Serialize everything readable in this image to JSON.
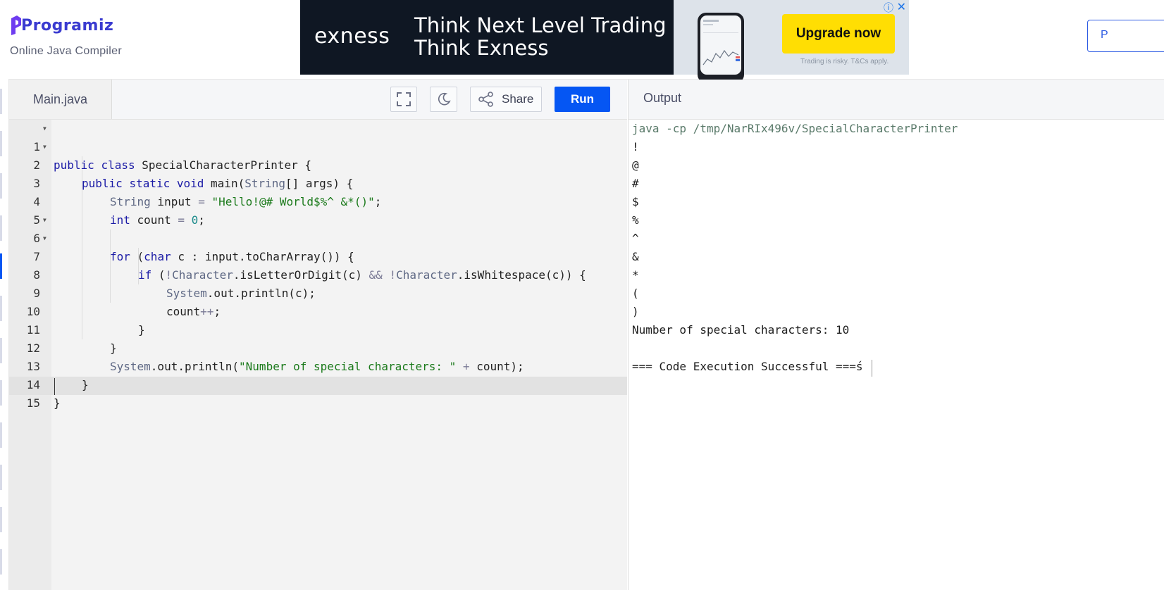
{
  "brand": {
    "logo_text": "Programiz",
    "subtitle": "Online Java Compiler"
  },
  "ad": {
    "brand": "exness",
    "headline_1": "Think Next Level Trading",
    "headline_2": "Think Exness",
    "cta": "Upgrade now",
    "note": "Trading is risky. T&Cs apply.",
    "info_icon": "info-icon",
    "close_icon": "close-icon"
  },
  "side_button": {
    "label": "P"
  },
  "editor": {
    "tab_label": "Main.java",
    "share_label": "Share",
    "run_label": "Run",
    "active_line": 15,
    "lines": [
      {
        "n": "1",
        "fold": true
      },
      {
        "n": "2",
        "fold": true
      },
      {
        "n": "3",
        "fold": false
      },
      {
        "n": "4",
        "fold": false
      },
      {
        "n": "5",
        "fold": false
      },
      {
        "n": "6",
        "fold": true
      },
      {
        "n": "7",
        "fold": true
      },
      {
        "n": "8",
        "fold": false
      },
      {
        "n": "9",
        "fold": false
      },
      {
        "n": "10",
        "fold": false
      },
      {
        "n": "11",
        "fold": false
      },
      {
        "n": "12",
        "fold": false
      },
      {
        "n": "13",
        "fold": false
      },
      {
        "n": "14",
        "fold": false
      },
      {
        "n": "15",
        "fold": false
      }
    ],
    "code": {
      "l1": {
        "a": "public",
        "b": " ",
        "c": "class",
        "d": " SpecialCharacterPrinter {"
      },
      "l2": {
        "a": "public",
        "b": " ",
        "c": "static",
        "d": " ",
        "e": "void",
        "f": " main(",
        "g": "String",
        "h": "[] args) {"
      },
      "l3": {
        "a": "String",
        "b": " input ",
        "c": "=",
        "d": " ",
        "e": "\"Hello!@# World$%^ &*()\"",
        "f": ";"
      },
      "l4": {
        "a": "int",
        "b": " count ",
        "c": "=",
        "d": " ",
        "e": "0",
        "f": ";"
      },
      "l6": {
        "a": "for",
        "b": " (",
        "c": "char",
        "d": " c : input.toCharArray()) {"
      },
      "l7": {
        "a": "if",
        "b": " (",
        "c": "!",
        "d": "Character",
        "e": ".isLetterOrDigit(c) ",
        "f": "&&",
        "g": " ",
        "h": "!",
        "i": "Character",
        "j": ".isWhitespace(c)) {"
      },
      "l8": {
        "a": "System",
        "b": ".out.println(c);"
      },
      "l9": {
        "a": "count",
        "b": "++",
        "c": ";"
      },
      "l10": {
        "a": "}"
      },
      "l11": {
        "a": "}"
      },
      "l12": {
        "a": "System",
        "b": ".out.println(",
        "c": "\"Number of special characters: \"",
        "d": " ",
        "e": "+",
        "f": " count);"
      },
      "l13": {
        "a": "}"
      },
      "l14": {
        "a": "}"
      }
    }
  },
  "output": {
    "title": "Output",
    "lines": [
      "java -cp /tmp/NarRIx496v/SpecialCharacterPrinter",
      "!",
      "@",
      "#",
      "$",
      "%",
      "^",
      "&",
      "*",
      "(",
      ")",
      "Number of special characters: 10",
      "",
      "=== Code Execution Successful ===ś"
    ]
  },
  "colors": {
    "accent": "#0556f3",
    "brand": "#3a3bd0",
    "ad_dark": "#0f1723",
    "ad_cta": "#ffde03"
  }
}
